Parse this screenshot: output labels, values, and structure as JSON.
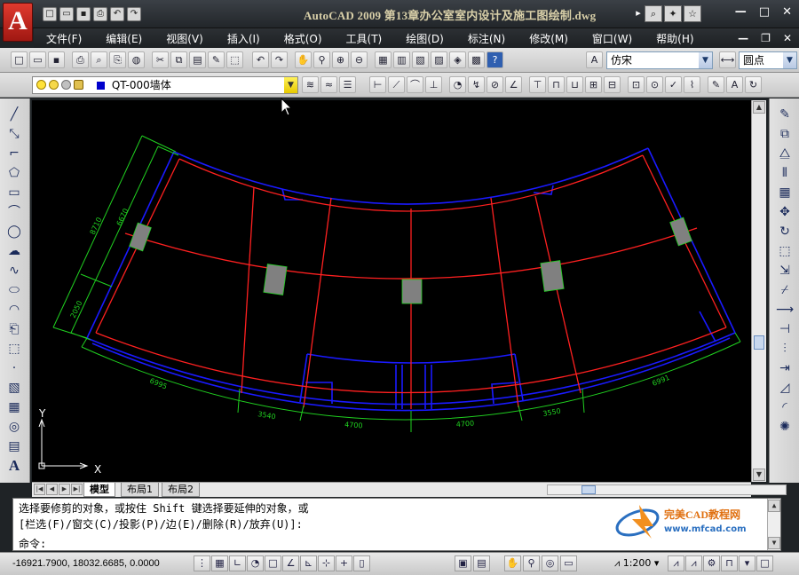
{
  "app": {
    "logo_letter": "A",
    "window_title": "AutoCAD 2009  第13章办公室室内设计及施工图绘制.dwg"
  },
  "menu": [
    "文件(F)",
    "编辑(E)",
    "视图(V)",
    "插入(I)",
    "格式(O)",
    "工具(T)",
    "绘图(D)",
    "标注(N)",
    "修改(M)",
    "窗口(W)",
    "帮助(H)"
  ],
  "toolbars": {
    "text_style": "仿宋",
    "dim_style": "圆点",
    "layer": "QT-000墙体"
  },
  "drawing": {
    "dims_left": [
      "8710",
      "6670",
      "2050"
    ],
    "dims_bottom": [
      "6995",
      "3540",
      "4700",
      "4700",
      "3550",
      "6991"
    ],
    "ucs_x": "X",
    "ucs_y": "Y",
    "colors": {
      "wall": "#1a1aff",
      "axis": "#ff2020",
      "dim": "#20d020",
      "column": "#808080"
    }
  },
  "tabs": [
    "模型",
    "布局1",
    "布局2"
  ],
  "command": {
    "line1": "选择要修剪的对象，或按住 Shift 键选择要延伸的对象，或",
    "line2": "[栏选(F)/窗交(C)/投影(P)/边(E)/删除(R)/放弃(U)]:",
    "line3": "命令:"
  },
  "watermark": {
    "brand": "完美CAD教程网",
    "url": "www.mfcad.com"
  },
  "status": {
    "coordinates": "-16921.7900, 18032.6685, 0.0000",
    "annotation_scale": "1:200"
  }
}
